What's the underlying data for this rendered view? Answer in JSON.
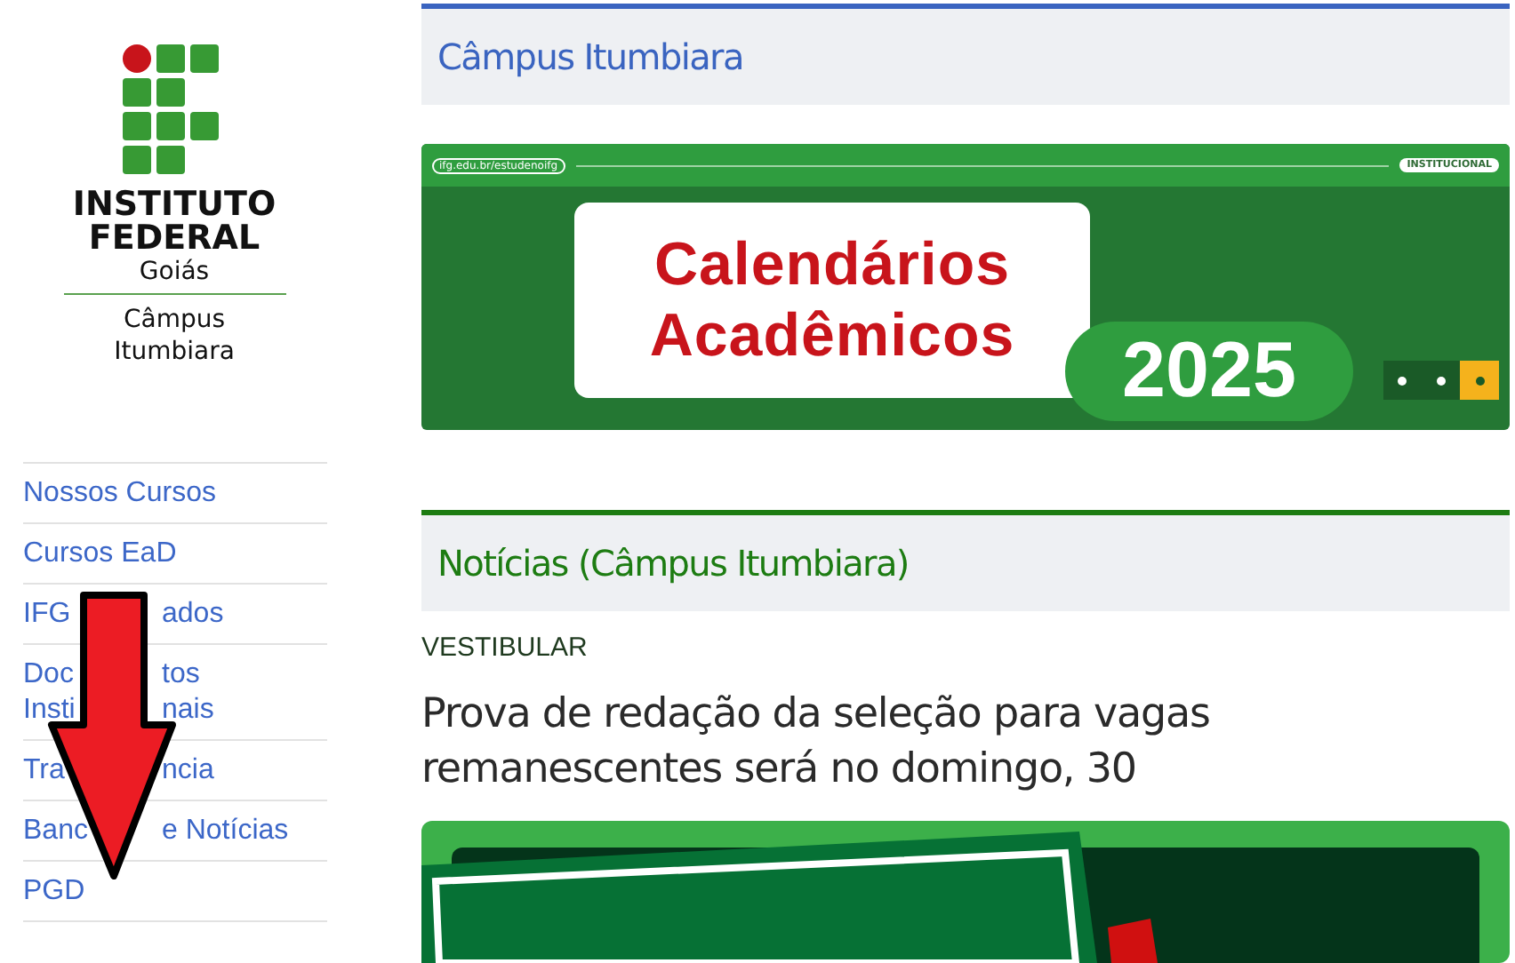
{
  "logo": {
    "line_1": "INSTITUTO",
    "line_2": "FEDERAL",
    "line_3": "Goiás",
    "campus": "Câmpus Itumbiara"
  },
  "menu": [
    {
      "lines": [
        [
          "Nossos Cursos"
        ]
      ]
    },
    {
      "lines": [
        [
          "Cursos EaD"
        ]
      ]
    },
    {
      "lines": [
        [
          "IFG",
          "ados"
        ]
      ]
    },
    {
      "lines": [
        [
          "Doc",
          "tos"
        ],
        [
          "Insti",
          "nais"
        ]
      ]
    },
    {
      "lines": [
        [
          "Tra",
          "ncia"
        ]
      ]
    },
    {
      "lines": [
        [
          "Banc",
          "e Notícias"
        ]
      ]
    },
    {
      "lines": [
        [
          "PGD"
        ]
      ]
    }
  ],
  "campus_section": {
    "title": "Câmpus Itumbiara",
    "banner": {
      "url": "ifg.edu.br/estudenoifg",
      "tag": "INSTITUCIONAL",
      "line_1": "Calendários",
      "line_2": "Acadêmicos",
      "year": "2025",
      "slides": [
        {
          "selected": false
        },
        {
          "selected": false
        },
        {
          "selected": true
        }
      ]
    }
  },
  "news_section": {
    "title": "Notícias (Câmpus Itumbiara)",
    "category": "VESTIBULAR",
    "headline": "Prova de redação da seleção para vagas remanescentes será no domingo, 30"
  }
}
